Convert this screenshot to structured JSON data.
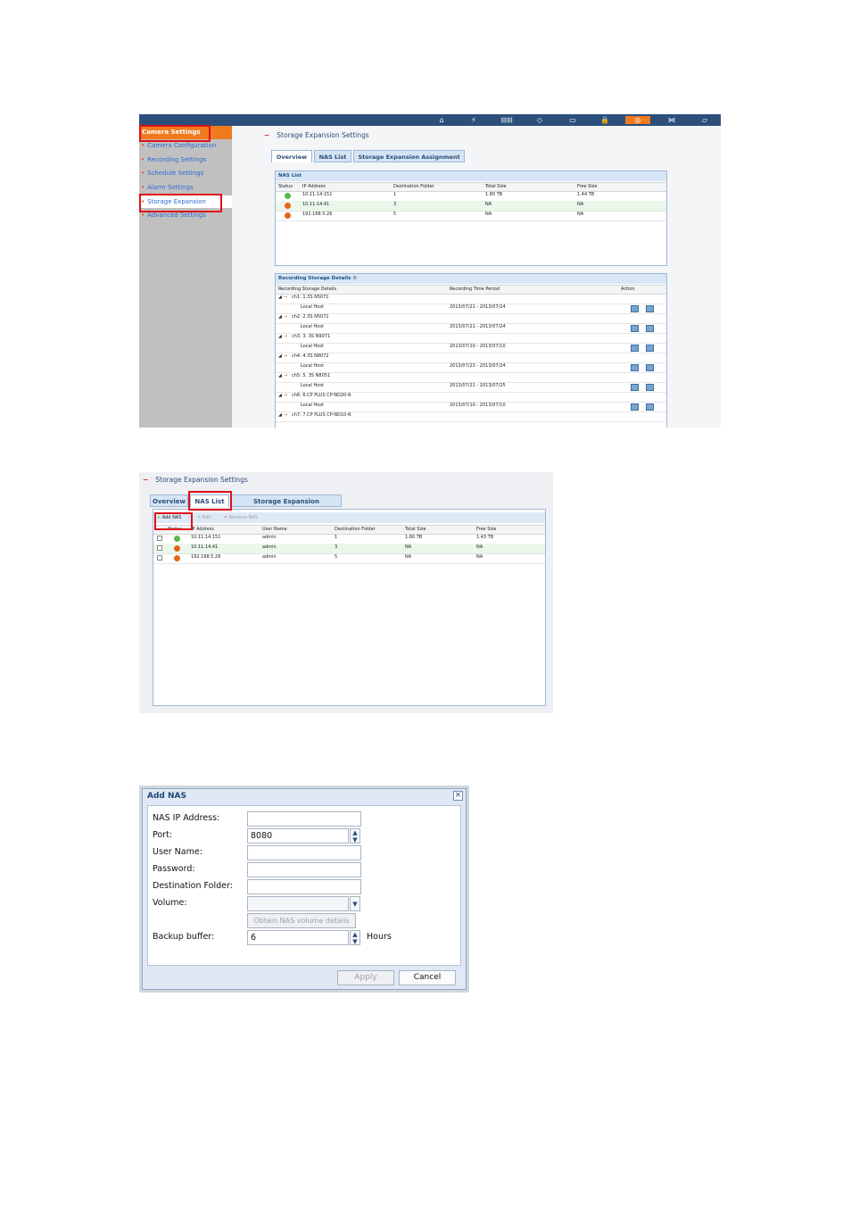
{
  "shot1": {
    "topbar_icons": [
      "home-icon",
      "flash-icon",
      "network-icon",
      "connector-icon",
      "storage-icon",
      "lock-icon",
      "camera-icon",
      "pip-icon",
      "display-icon"
    ],
    "sidebar": {
      "header": "Camera Settings",
      "items": [
        "Camera Configuration",
        "Recording Settings",
        "Schedule Settings",
        "Alarm Settings",
        "Storage Expansion",
        "Advanced Settings"
      ]
    },
    "section_title": "Storage Expansion Settings",
    "tabs": [
      "Overview",
      "NAS List",
      "Storage Expansion Assignment"
    ],
    "nas_list": {
      "title": "NAS List",
      "columns": [
        "Status",
        "IP Address",
        "Destination Folder",
        "Total Size",
        "Free Size"
      ],
      "rows": [
        {
          "status": "ok",
          "ip": "10.11.14.151",
          "folder": "1",
          "total": "1.80 TB",
          "free": "1.44 TB"
        },
        {
          "status": "error",
          "ip": "10.11.14.41",
          "folder": "3",
          "total": "NA",
          "free": "NA"
        },
        {
          "status": "error",
          "ip": "192.168.5.26",
          "folder": "5",
          "total": "NA",
          "free": "NA"
        }
      ]
    },
    "recording": {
      "title": "Recording Storage Details",
      "columns": [
        "Recording Storage Details",
        "Recording Time Period",
        "Action"
      ],
      "rows": [
        {
          "kind": "channel",
          "label": "ch1: 1.3S N5071"
        },
        {
          "kind": "entry",
          "label": "Local Host",
          "period": "2013/07/21 - 2013/07/24"
        },
        {
          "kind": "channel",
          "label": "ch2: 2.3S N5071"
        },
        {
          "kind": "entry",
          "label": "Local Host",
          "period": "2013/07/21 - 2013/07/24"
        },
        {
          "kind": "channel",
          "label": "ch3: 3. 3S N9071"
        },
        {
          "kind": "entry",
          "label": "Local Host",
          "period": "2013/07/10 - 2013/07/10"
        },
        {
          "kind": "channel",
          "label": "ch4: 4.3S N8072"
        },
        {
          "kind": "entry",
          "label": "Local Host",
          "period": "2013/07/23 - 2013/07/24"
        },
        {
          "kind": "channel",
          "label": "ch5: 5. 3S N8051"
        },
        {
          "kind": "entry",
          "label": "Local Host",
          "period": "2013/07/21 - 2013/07/25"
        },
        {
          "kind": "channel",
          "label": "ch6: 6.CP PLUS CP-ND20-R"
        },
        {
          "kind": "entry",
          "label": "Local Host",
          "period": "2013/07/10 - 2013/07/10"
        },
        {
          "kind": "channel",
          "label": "ch7: 7.CP PLUS CP-ND10-R"
        }
      ]
    }
  },
  "shot2": {
    "section_title": "Storage Expansion Settings",
    "tabs": [
      "Overview",
      "NAS List",
      "Storage Expansion Assignment"
    ],
    "toolbar": {
      "add": "Add NAS",
      "edit": "Edit",
      "remove": "Remove NAS"
    },
    "columns": [
      "Status",
      "IP Address",
      "User Name",
      "Destination Folder",
      "Total Size",
      "Free Size"
    ],
    "rows": [
      {
        "status": "ok",
        "ip": "10.11.14.151",
        "user": "admin",
        "folder": "1",
        "total": "1.80 TB",
        "free": "1.43 TB"
      },
      {
        "status": "error",
        "ip": "10.11.14.41",
        "user": "admin",
        "folder": "3",
        "total": "NA",
        "free": "NA"
      },
      {
        "status": "error",
        "ip": "192.168.5.26",
        "user": "admin",
        "folder": "5",
        "total": "NA",
        "free": "NA"
      }
    ]
  },
  "shot3": {
    "title": "Add NAS",
    "close": "×",
    "fields": {
      "ip_label": "NAS IP Address:",
      "ip_value": "",
      "port_label": "Port:",
      "port_value": "8080",
      "user_label": "User Name:",
      "user_value": "",
      "password_label": "Password:",
      "password_value": "",
      "folder_label": "Destination Folder:",
      "folder_value": "",
      "volume_label": "Volume:",
      "volume_value": "",
      "obtain_button": "Obtain NAS volume details",
      "buffer_label": "Backup buffer:",
      "buffer_value": "6",
      "buffer_unit": "Hours"
    },
    "buttons": {
      "apply": "Apply",
      "cancel": "Cancel"
    }
  },
  "colors": {
    "accent": "#f07a1e",
    "header": "#2c4f7c",
    "highlight": "#e0101a",
    "link": "#2b6ad6"
  }
}
